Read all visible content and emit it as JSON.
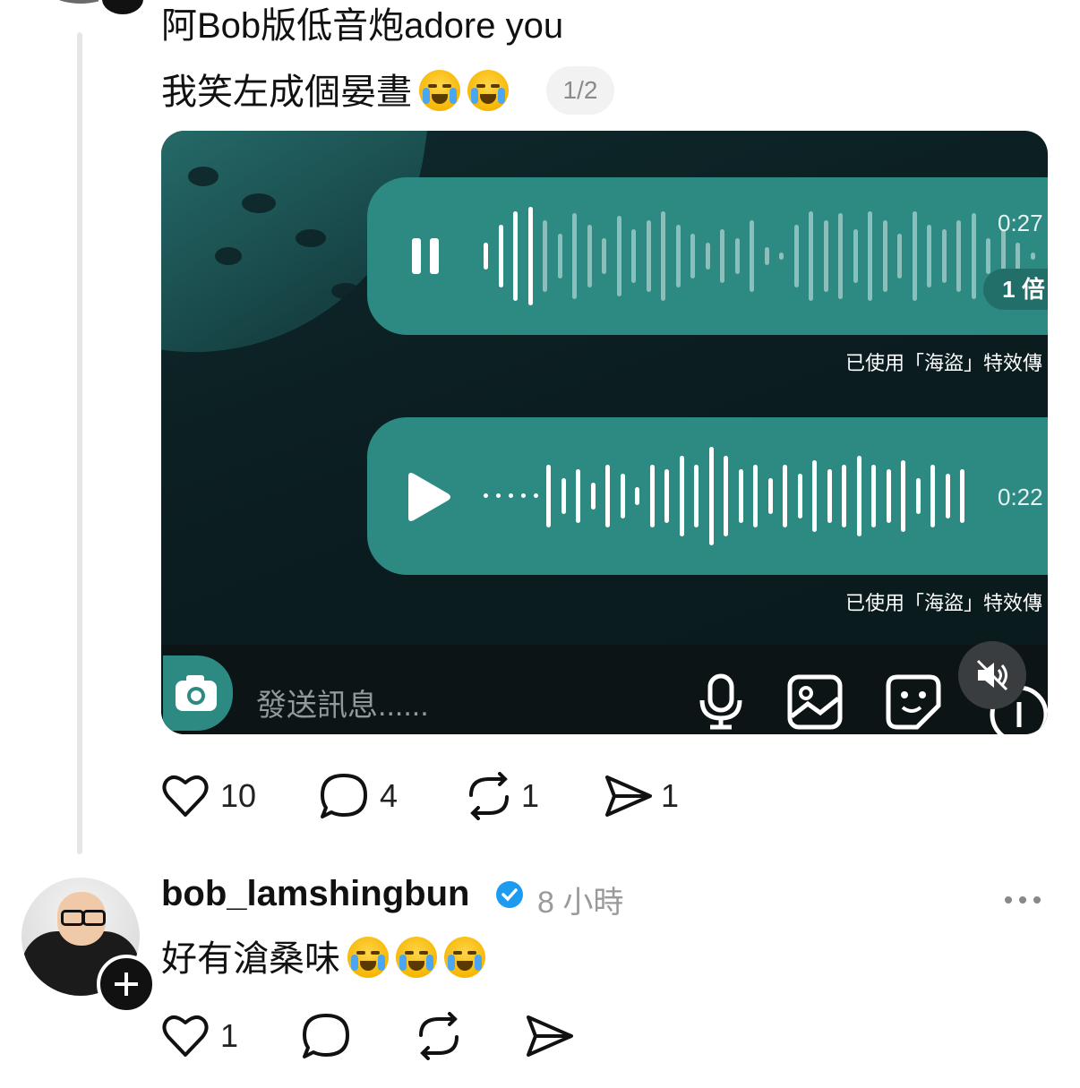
{
  "post1": {
    "line1": "阿Bob版低音炮adore you",
    "line2": "我笑左成個晏晝",
    "line2_emojis": [
      "loudly-crying-face",
      "loudly-crying-face"
    ],
    "page_indicator": "1/2"
  },
  "screenshot": {
    "voice1": {
      "duration": "0:27",
      "speed": "1 倍",
      "state": "playing",
      "icon": "pause-icon"
    },
    "fx_note_1": "已使用「海盜」特效傳",
    "voice2": {
      "duration": "0:22",
      "state": "paused",
      "icon": "play-icon"
    },
    "fx_note_2": "已使用「海盜」特效傳",
    "input_placeholder": "發送訊息......",
    "icons": [
      "camera-icon",
      "microphone-icon",
      "image-icon",
      "sticker-icon",
      "mute-icon"
    ]
  },
  "post1_actions": {
    "likes": "10",
    "comments": "4",
    "reposts": "1",
    "shares": "1"
  },
  "post2": {
    "username": "bob_lamshingbun",
    "verified": true,
    "time": "8 小時",
    "text": "好有滄桑味",
    "emojis": [
      "face-with-tears-of-joy",
      "face-with-tears-of-joy",
      "face-with-tears-of-joy"
    ]
  },
  "post2_actions": {
    "likes": "1"
  },
  "colors": {
    "voice_bubble": "#2c8a83",
    "verified": "#1d9bf0"
  }
}
